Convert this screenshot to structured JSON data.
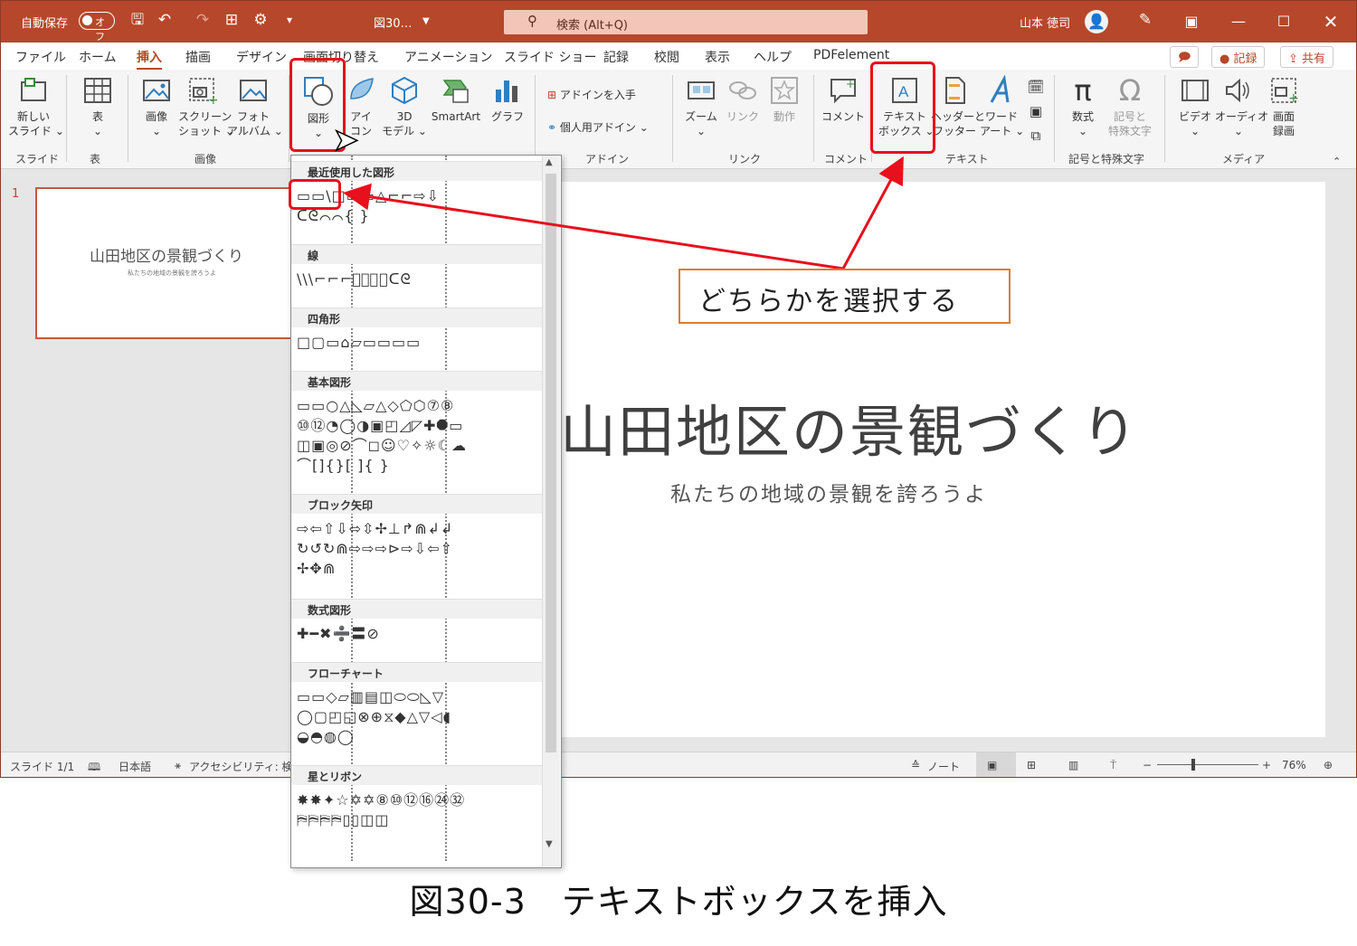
{
  "titlebar": {
    "autosave_label": "自動保存",
    "autosave_state": "オフ",
    "filename": "図30…",
    "search_placeholder": "検索 (Alt+Q)",
    "user_name": "山本 徳司"
  },
  "tabs": [
    {
      "label": "ファイル"
    },
    {
      "label": "ホーム"
    },
    {
      "label": "挿入"
    },
    {
      "label": "描画"
    },
    {
      "label": "デザイン"
    },
    {
      "label": "画面切り替え"
    },
    {
      "label": "アニメーション"
    },
    {
      "label": "スライド ショー"
    },
    {
      "label": "記録"
    },
    {
      "label": "校閲"
    },
    {
      "label": "表示"
    },
    {
      "label": "ヘルプ"
    },
    {
      "label": "PDFelement"
    }
  ],
  "tab_buttons": {
    "record": "● 記録",
    "share": "共有"
  },
  "ribbon": {
    "new_slide": "新しい\nスライド ⌄",
    "table": "表\n⌄",
    "image": "画像\n⌄",
    "screenshot": "スクリーン\nショット ⌄",
    "photo_album": "フォト\nアルバム ⌄",
    "shapes": "図形\n⌄",
    "icons": "アイ\nコン",
    "model3d": "3D\nモデル ⌄",
    "smartart": "SmartArt",
    "chart": "グラフ",
    "get_addins": "アドインを入手",
    "my_addins": "個人用アドイン ⌄",
    "zoom": "ズーム\n⌄",
    "link": "リンク",
    "action": "動作",
    "comment": "コメント",
    "textbox": "テキスト\nボックス ⌄",
    "header_footer": "ヘッダーと\nフッター",
    "wordart": "ワード\nアート ⌄",
    "equation": "数式\n⌄",
    "symbol": "記号と\n特殊文字",
    "video": "ビデオ\n⌄",
    "audio": "オーディオ\n⌄",
    "screen_record": "画面\n録画",
    "groups": {
      "slides": "スライド",
      "tables": "表",
      "images": "画像",
      "addins": "アドイン",
      "links": "リンク",
      "comments": "コメント",
      "text": "テキスト",
      "symbols": "記号と特殊文字",
      "media": "メディア"
    }
  },
  "thumbnail": {
    "number": "1",
    "title": "山田地区の景観づくり",
    "subtitle": "私たちの地域の景観を誇ろうよ"
  },
  "slide": {
    "title": "山田地区の景観づくり",
    "subtitle": "私たちの地域の景観を誇ろうよ"
  },
  "status": {
    "slide_count": "スライド 1/1",
    "language": "日本語",
    "accessibility": "アクセシビリティ: 検討",
    "notes": "ノート",
    "zoom": "76%"
  },
  "gallery": {
    "sections": [
      {
        "title": "最近使用した図形",
        "rows": [
          "▭▭\\□▭▭△⌐⌐⇨⇩",
          "ᑕᘓ⌒⌒{ }"
        ]
      },
      {
        "title": "線",
        "rows": [
          "\\\\\\⌐⌐⌐ﾞﾞﾞ⌒ᑕᘓ"
        ]
      },
      {
        "title": "四角形",
        "rows": [
          "□▢▭⌂▱▭▭▭▭"
        ]
      },
      {
        "title": "基本図形",
        "rows": [
          "▭▭○△◺▱△◇⬠⬡⑦⑧",
          "⑩⑫◔◯◑▣◰◿◸✚⯃▭",
          "◫▣◎⊘⌒◻☺♡✧☼☾☁",
          "⌒[]{}[ ]{ }"
        ]
      },
      {
        "title": "ブロック矢印",
        "rows": [
          "⇨⇦⇧⇩⬄⇳✢⊥↱⋒↲↲",
          "↻↺↻⋒⇨⇨⇨⊳⇨⇩⇦⇧",
          "✢✥⋒"
        ]
      },
      {
        "title": "数式図形",
        "rows": [
          "✚━✖➗〓⊘"
        ]
      },
      {
        "title": "フローチャート",
        "rows": [
          "▭▭◇▱▥▤◫⬭⬭◺▽",
          "◯▢◰◱⊗⊕⧖◆△▽◁◖",
          "◒◓◍◯"
        ]
      },
      {
        "title": "星とリボン",
        "rows": [
          "✸✸✦☆✡✡⑧⑩⑫⑯㉔㉜",
          "⛿⛿⛿⛿▯▯◫◫"
        ]
      }
    ]
  },
  "callout": {
    "text": "どちらかを選択する"
  },
  "caption": {
    "text": "図30-3　テキストボックスを挿入"
  },
  "colors": {
    "accent": "#b7472a",
    "highlight": "#e8101c",
    "callout_border": "#e07b2a"
  }
}
